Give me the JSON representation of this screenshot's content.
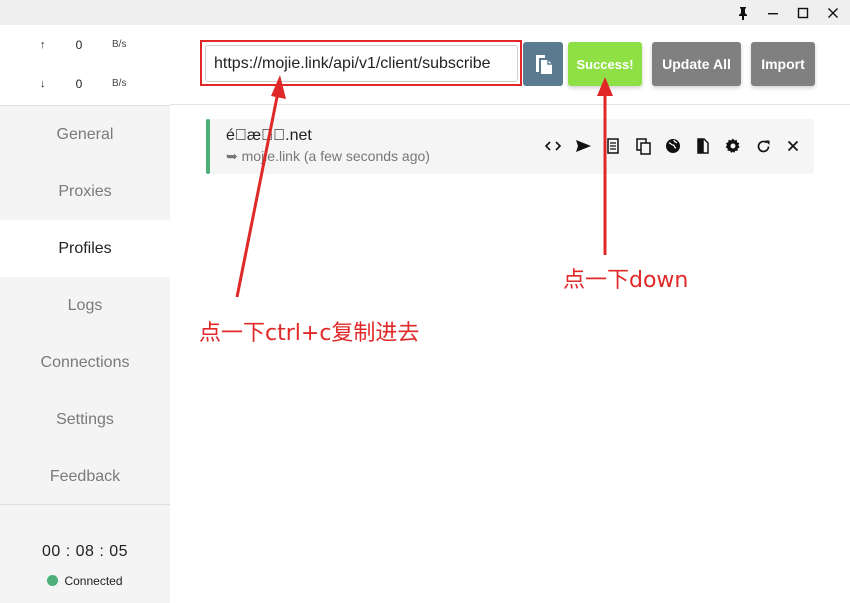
{
  "window": {
    "controls": [
      "pin-icon",
      "minimize-icon",
      "maximize-icon",
      "close-icon"
    ]
  },
  "traffic": {
    "up_arrow": "↑",
    "down_arrow": "↓",
    "up_value": "0",
    "down_value": "0",
    "up_unit": "B/s",
    "down_unit": "B/s"
  },
  "sidebar": {
    "items": [
      {
        "label": "General"
      },
      {
        "label": "Proxies"
      },
      {
        "label": "Profiles"
      },
      {
        "label": "Logs"
      },
      {
        "label": "Connections"
      },
      {
        "label": "Settings"
      },
      {
        "label": "Feedback"
      }
    ],
    "active": "Profiles",
    "timer": "00 : 08 : 05",
    "status": "Connected",
    "status_color": "#4caf78"
  },
  "header": {
    "url_value": "https://mojie.link/api/v1/client/subscribe",
    "paste_icon": "paste-icon",
    "success_label": "Success!",
    "update_all_label": "Update All",
    "import_label": "Import",
    "success_color": "#8ee045",
    "button_color": "#808080"
  },
  "profiles": [
    {
      "name": "é\u0000æ\u0000\u0000.net",
      "subtitle": "➥ mojie.link (a few seconds ago)",
      "icons": [
        "code-icon",
        "send-icon",
        "list-icon",
        "copy-icon",
        "globe-icon",
        "file-diff-icon",
        "gear-icon",
        "refresh-icon",
        "close-icon"
      ]
    }
  ],
  "annotations": {
    "left_text": "点一下ctrl+c复制进去",
    "right_text": "点一下down",
    "color": "#e02828"
  }
}
